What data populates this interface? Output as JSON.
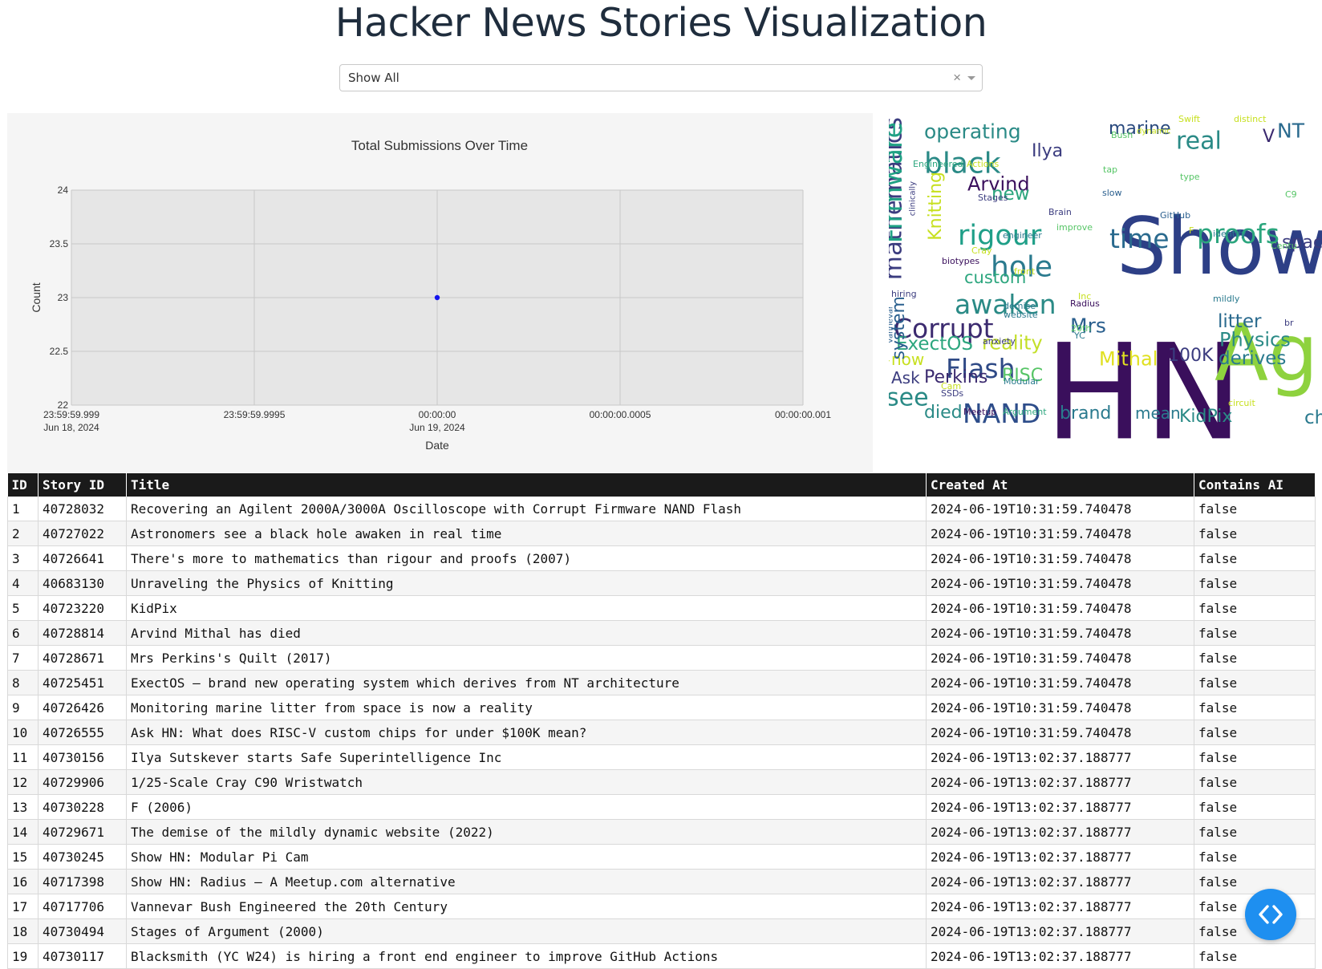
{
  "page": {
    "title": "Hacker News Stories Visualization"
  },
  "filter": {
    "selected": "Show All",
    "clear_symbol": "×"
  },
  "chart_data": {
    "type": "scatter",
    "title": "Total Submissions Over Time",
    "xlabel": "Date",
    "ylabel": "Count",
    "ylim": [
      22,
      24
    ],
    "yticks": [
      "22",
      "22.5",
      "23",
      "23.5",
      "24"
    ],
    "xticks": [
      [
        "23:59:59.999",
        "Jun 18, 2024"
      ],
      [
        "23:59:59.9995",
        ""
      ],
      [
        "00:00:00",
        "Jun 19, 2024"
      ],
      [
        "00:00:00.0005",
        ""
      ],
      [
        "00:00:00.001",
        ""
      ]
    ],
    "x": [
      "2024-06-19"
    ],
    "y": [
      23
    ],
    "marker_color": "#1515ee",
    "grid": true
  },
  "wordcloud": {
    "words": [
      {
        "text": "Show",
        "color": "#2d3f86"
      },
      {
        "text": "HN",
        "color": "#3a0f5c"
      },
      {
        "text": "Recove",
        "color": "#2a5f7e"
      },
      {
        "text": "Ag",
        "color": "#8ed23e"
      },
      {
        "text": "operating",
        "color": "#2a8a86"
      },
      {
        "text": "black",
        "color": "#2a8a86"
      },
      {
        "text": "mathematics",
        "color": "#3b3c7f"
      },
      {
        "text": "Firmware",
        "color": "#1fa184"
      },
      {
        "text": "Knitting",
        "color": "#c7e01f"
      },
      {
        "text": "rigour",
        "color": "#1f9f88"
      },
      {
        "text": "hole",
        "color": "#2a7a8e"
      },
      {
        "text": "awaken",
        "color": "#2a8a86"
      },
      {
        "text": "Corrupt",
        "color": "#3b2a6f"
      },
      {
        "text": "ExectOS",
        "color": "#2ca67e"
      },
      {
        "text": "reality",
        "color": "#c3df28"
      },
      {
        "text": "Flash",
        "color": "#2f4a86"
      },
      {
        "text": "Perkins",
        "color": "#3b2a6f"
      },
      {
        "text": "NAND",
        "color": "#2d4d8a"
      },
      {
        "text": "see",
        "color": "#2a8a86"
      },
      {
        "text": "died",
        "color": "#2a8a86"
      },
      {
        "text": "Ask",
        "color": "#3b3c7f"
      },
      {
        "text": "now",
        "color": "#c7e01f"
      },
      {
        "text": "RISC",
        "color": "#56c566"
      },
      {
        "text": "brand",
        "color": "#2a7a8e"
      },
      {
        "text": "mean",
        "color": "#2a7a8e"
      },
      {
        "text": "KidPix",
        "color": "#2a8a86"
      },
      {
        "text": "time",
        "color": "#2a6a8e"
      },
      {
        "text": "proofs",
        "color": "#2ca67e"
      },
      {
        "text": "real",
        "color": "#2a8a86"
      },
      {
        "text": "marine",
        "color": "#2a4a7e"
      },
      {
        "text": "Ilya",
        "color": "#3b3c7f"
      },
      {
        "text": "Arvind",
        "color": "#3a0f5c"
      },
      {
        "text": "new",
        "color": "#2ca67e"
      },
      {
        "text": "system",
        "color": "#2a5f8e"
      },
      {
        "text": "Sutskever",
        "color": "#2a7a8e"
      },
      {
        "text": "Mrs",
        "color": "#2a5f8e"
      },
      {
        "text": "Mithal",
        "color": "#e0e020"
      },
      {
        "text": "100K",
        "color": "#3b3c7f"
      },
      {
        "text": "litter",
        "color": "#2a6a8e"
      },
      {
        "text": "Physics",
        "color": "#2a8a86"
      },
      {
        "text": "derives",
        "color": "#2a7a8e"
      },
      {
        "text": "chi",
        "color": "#2a7a8e"
      },
      {
        "text": "spac",
        "color": "#3b3c7f"
      },
      {
        "text": "NT",
        "color": "#2a6a8e"
      },
      {
        "text": "V",
        "color": "#3b2a6f"
      },
      {
        "text": "custom",
        "color": "#2ca67e"
      },
      {
        "text": "Swift",
        "color": "#c7e01f"
      },
      {
        "text": "distinct",
        "color": "#c7e01f"
      },
      {
        "text": "Bush",
        "color": "#56c566"
      },
      {
        "text": "dynamic",
        "color": "#c7e01f"
      },
      {
        "text": "Vannevar",
        "color": "#2a5f8e"
      },
      {
        "text": "Engineered",
        "color": "#2ca67e"
      },
      {
        "text": "Actions",
        "color": "#c7e01f"
      },
      {
        "text": "Stages",
        "color": "#3b3c7f"
      },
      {
        "text": "clinically",
        "color": "#3b3c7f"
      },
      {
        "text": "tap",
        "color": "#56c566"
      },
      {
        "text": "slow",
        "color": "#2a5f8e"
      },
      {
        "text": "end",
        "color": "#2a7a8e"
      },
      {
        "text": "type",
        "color": "#56c566"
      },
      {
        "text": "Brain",
        "color": "#3b3c7f"
      },
      {
        "text": "GitHub",
        "color": "#2a5f8e"
      },
      {
        "text": "improve",
        "color": "#56c566"
      },
      {
        "text": "engineer",
        "color": "#2a7a8e"
      },
      {
        "text": "identify",
        "color": "#2a7a8e"
      },
      {
        "text": "Cray",
        "color": "#c7e01f"
      },
      {
        "text": "biotypes",
        "color": "#3a0f5c"
      },
      {
        "text": "front",
        "color": "#c7e01f"
      },
      {
        "text": "hiring",
        "color": "#3b3c7f"
      },
      {
        "text": "Inc",
        "color": "#c7e01f"
      },
      {
        "text": "Radius",
        "color": "#3a0f5c"
      },
      {
        "text": "demise",
        "color": "#2a7a8e"
      },
      {
        "text": "website",
        "color": "#2a7a8e"
      },
      {
        "text": "20th",
        "color": "#56c566"
      },
      {
        "text": "YC",
        "color": "#2a7a8e"
      },
      {
        "text": "anxiety",
        "color": "#3b3c7f"
      },
      {
        "text": "depression",
        "color": "#c7e01f"
      },
      {
        "text": "mildly",
        "color": "#2a7a8e"
      },
      {
        "text": "Cam",
        "color": "#c7e01f"
      },
      {
        "text": "SSDs",
        "color": "#3b3c7f"
      },
      {
        "text": "Modular",
        "color": "#2a7a8e"
      },
      {
        "text": "Meetup",
        "color": "#3a0f5c"
      },
      {
        "text": "Argument",
        "color": "#2ca67e"
      },
      {
        "text": "circuit",
        "color": "#c7e01f"
      },
      {
        "text": "Centu",
        "color": "#56c566"
      },
      {
        "text": "C9",
        "color": "#56c566"
      },
      {
        "text": "F",
        "color": "#c7e01f"
      },
      {
        "text": "br",
        "color": "#3b3c7f"
      }
    ]
  },
  "table": {
    "headers": [
      "ID",
      "Story ID",
      "Title",
      "Created At",
      "Contains AI"
    ],
    "rows": [
      [
        "1",
        "40728032",
        "Recovering an Agilent 2000A/3000A Oscilloscope with Corrupt Firmware NAND Flash",
        "2024-06-19T10:31:59.740478",
        "false"
      ],
      [
        "2",
        "40727022",
        "Astronomers see a black hole awaken in real time",
        "2024-06-19T10:31:59.740478",
        "false"
      ],
      [
        "3",
        "40726641",
        "There's more to mathematics than rigour and proofs (2007)",
        "2024-06-19T10:31:59.740478",
        "false"
      ],
      [
        "4",
        "40683130",
        "Unraveling the Physics of Knitting",
        "2024-06-19T10:31:59.740478",
        "false"
      ],
      [
        "5",
        "40723220",
        "KidPix",
        "2024-06-19T10:31:59.740478",
        "false"
      ],
      [
        "6",
        "40728814",
        "Arvind Mithal has died",
        "2024-06-19T10:31:59.740478",
        "false"
      ],
      [
        "7",
        "40728671",
        "Mrs Perkins's Quilt (2017)",
        "2024-06-19T10:31:59.740478",
        "false"
      ],
      [
        "8",
        "40725451",
        "ExectOS – brand new operating system which derives from NT architecture",
        "2024-06-19T10:31:59.740478",
        "false"
      ],
      [
        "9",
        "40726426",
        "Monitoring marine litter from space is now a reality",
        "2024-06-19T10:31:59.740478",
        "false"
      ],
      [
        "10",
        "40726555",
        "Ask HN: What does RISC-V custom chips for under $100K mean?",
        "2024-06-19T10:31:59.740478",
        "false"
      ],
      [
        "11",
        "40730156",
        "Ilya Sutskever starts Safe Superintelligence Inc",
        "2024-06-19T13:02:37.188777",
        "false"
      ],
      [
        "12",
        "40729906",
        "1/25-Scale Cray C90 Wristwatch",
        "2024-06-19T13:02:37.188777",
        "false"
      ],
      [
        "13",
        "40730228",
        "F (2006)",
        "2024-06-19T13:02:37.188777",
        "false"
      ],
      [
        "14",
        "40729671",
        "The demise of the mildly dynamic website (2022)",
        "2024-06-19T13:02:37.188777",
        "false"
      ],
      [
        "15",
        "40730245",
        "Show HN: Modular Pi Cam",
        "2024-06-19T13:02:37.188777",
        "false"
      ],
      [
        "16",
        "40717398",
        "Show HN: Radius – A Meetup.com alternative",
        "2024-06-19T13:02:37.188777",
        "false"
      ],
      [
        "17",
        "40717706",
        "Vannevar Bush Engineered the 20th Century",
        "2024-06-19T13:02:37.188777",
        "false"
      ],
      [
        "18",
        "40730494",
        "Stages of Argument (2000)",
        "2024-06-19T13:02:37.188777",
        "false"
      ],
      [
        "19",
        "40730117",
        "Blacksmith (YC W24) is hiring a front end engineer to improve GitHub Actions",
        "2024-06-19T13:02:37.188777",
        "false"
      ]
    ]
  },
  "fab": {
    "icon": "code-icon",
    "color": "#1e8ff0"
  }
}
